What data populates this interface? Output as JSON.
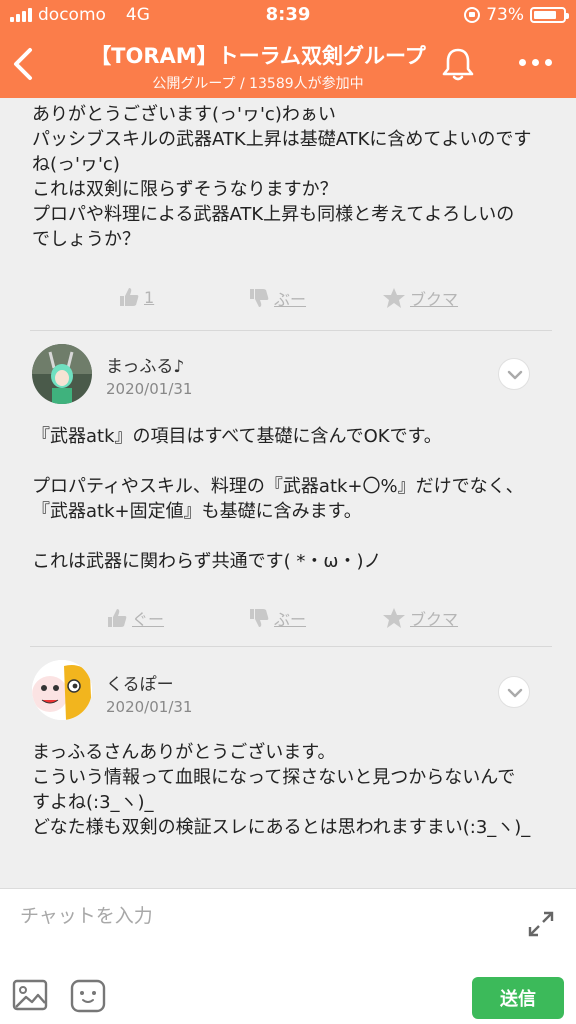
{
  "status_bar": {
    "carrier": "docomo",
    "network": "4G",
    "time": "8:39",
    "battery": "73%"
  },
  "header": {
    "title": "【TORAM】トーラム双剣グループ",
    "subtitle": "公開グループ / 13589人が参加中"
  },
  "messages": [
    {
      "text": "ありがとうございます(っ'ヮ'c)わぁい\nパッシブスキルの武器ATK上昇は基礎ATKに含めてよいのですね(っ'ヮ'c)\nこれは双剣に限らずそうなりますか？\nプロパや料理による武器ATK上昇も同様と考えてよろしいのでしょうか？",
      "like_label": "1",
      "dislike_label": "ぶー",
      "bookmark_label": "ブクマ"
    },
    {
      "user": "まっふる♪",
      "date": "2020/01/31",
      "text": "『武器atk』の項目はすべて基礎に含んでOKです。\n\nプロパティやスキル、料理の『武器atk+〇%』だけでなく、『武器atk+固定値』も基礎に含みます。\n\nこれは武器に関わらず共通です( *・ω・)ノ",
      "like_label": "ぐー",
      "dislike_label": "ぶー",
      "bookmark_label": "ブクマ"
    },
    {
      "user": "くるぽー",
      "date": "2020/01/31",
      "text": "まっふるさんありがとうございます。\nこういう情報って血眼になって探さないと見つからないんですよね(:3_ヽ)_\nどなた様も双剣の検証スレにあるとは思われますまい(:3_ヽ)_"
    }
  ],
  "input": {
    "placeholder": "チャットを入力",
    "send_label": "送信"
  },
  "colors": {
    "header": "#fb7d4a",
    "send_button": "#3cba5a",
    "background": "#efefef"
  },
  "icons": [
    "back-icon",
    "bell-icon",
    "more-icon",
    "thumbs-up-icon",
    "thumbs-down-icon",
    "star-icon",
    "chevron-down-icon",
    "expand-icon",
    "image-icon",
    "emoji-icon"
  ]
}
